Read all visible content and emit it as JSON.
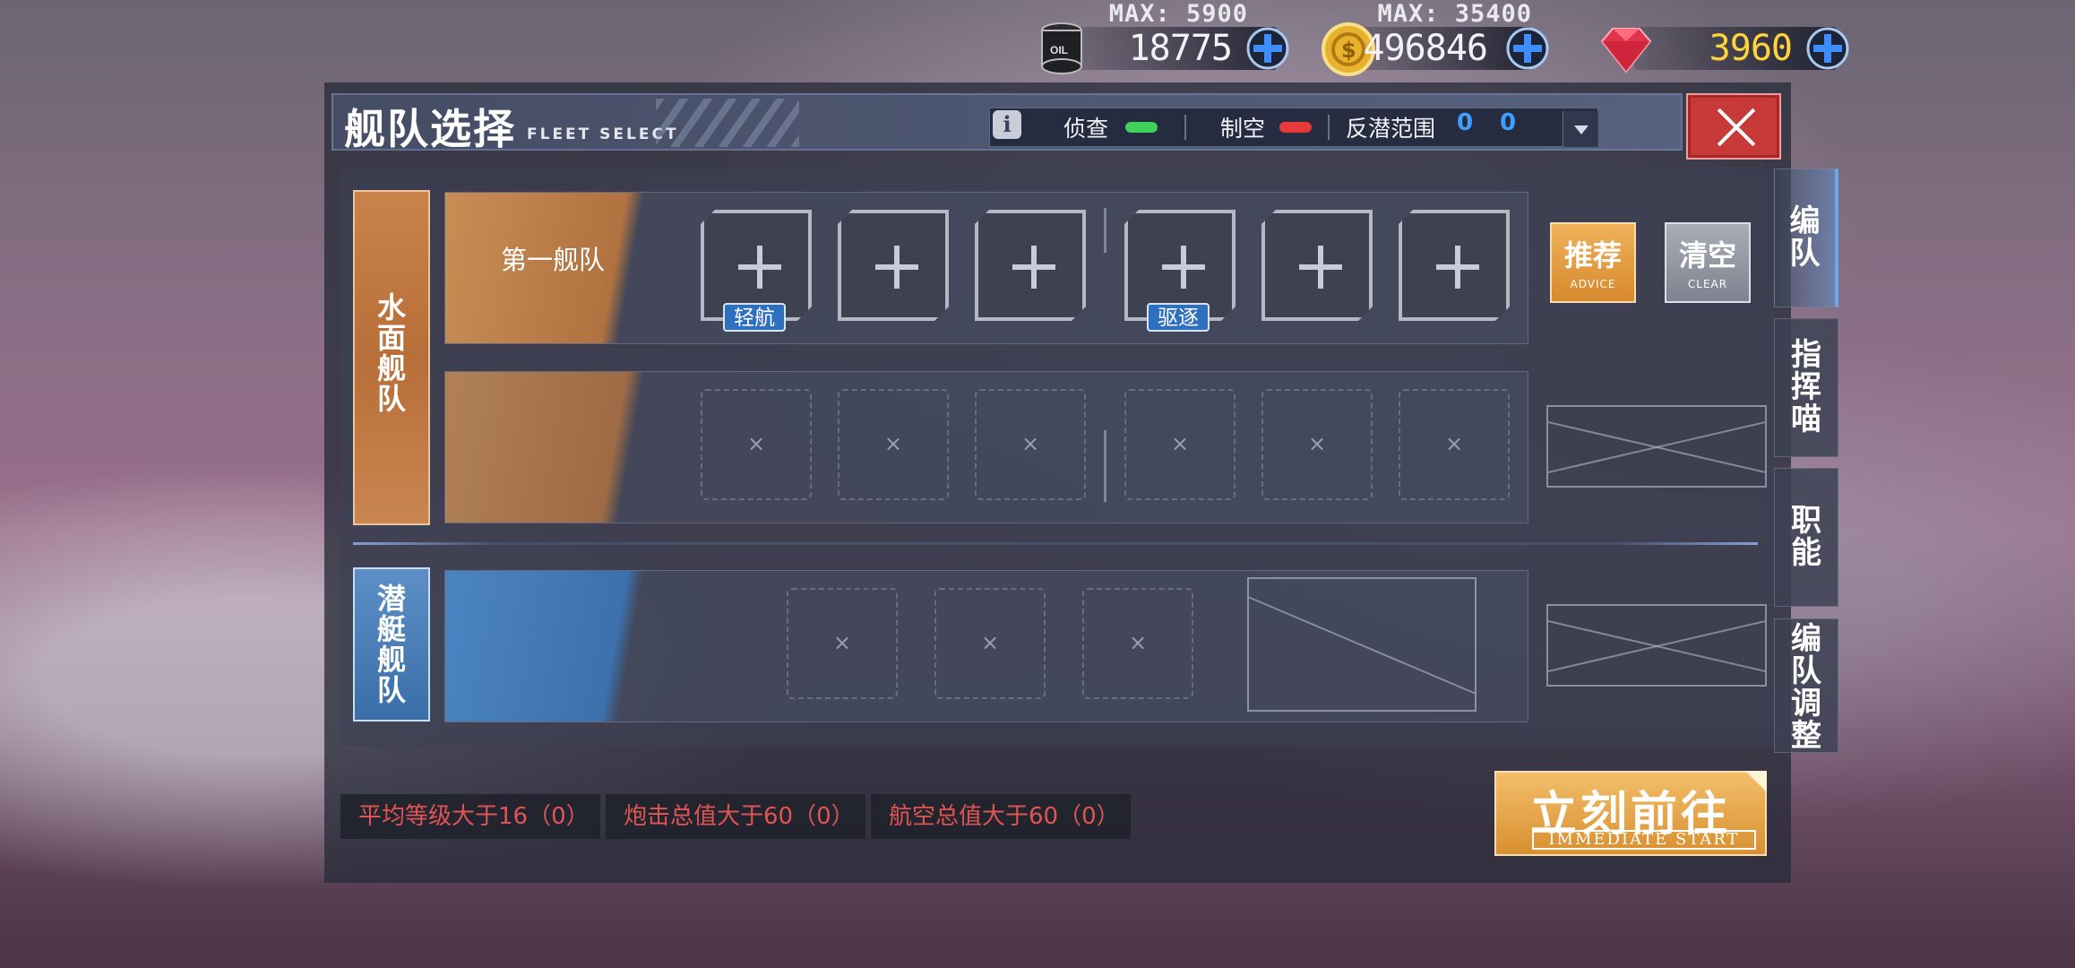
{
  "resources": {
    "oil": {
      "max_label": "MAX: 5900",
      "value": "18775",
      "icon": "oil-barrel-icon"
    },
    "gold": {
      "max_label": "MAX: 35400",
      "value": "496846",
      "icon": "gold-coin-icon"
    },
    "gem": {
      "max_label": "",
      "value": "3960",
      "icon": "gem-icon"
    }
  },
  "header": {
    "title_cn": "舰队选择",
    "title_en": "FLEET SELECT",
    "info": "i",
    "stats": [
      {
        "label": "侦查",
        "status_color": "#3fd15a"
      },
      {
        "label": "制空",
        "status_color": "#e53a3a"
      },
      {
        "label": "反潜范围",
        "values": [
          "0",
          "0"
        ]
      }
    ]
  },
  "surface_fleet": {
    "side_label": "水面舰队",
    "fleet1_name": "第一舰队",
    "tags": [
      "轻航",
      "驱逐"
    ],
    "empty_mark": "×"
  },
  "sub_fleet": {
    "side_label": "潜艇舰队",
    "empty_mark": "×"
  },
  "buttons": {
    "advice_cn": "推荐",
    "advice_en": "ADVICE",
    "clear_cn": "清空",
    "clear_en": "CLEAR",
    "start_cn": "立刻前往",
    "start_en": "IMMEDIATE START"
  },
  "tabs": [
    "编队",
    "指挥喵",
    "职能",
    "编队调整"
  ],
  "conditions": [
    "平均等级大于16（0）",
    "炮击总值大于60（0）",
    "航空总值大于60（0）"
  ],
  "colors": {
    "accent_orange": "#d7892e",
    "accent_blue": "#3a78bd",
    "close_red": "#c8393a",
    "condition_red": "#e05454"
  }
}
